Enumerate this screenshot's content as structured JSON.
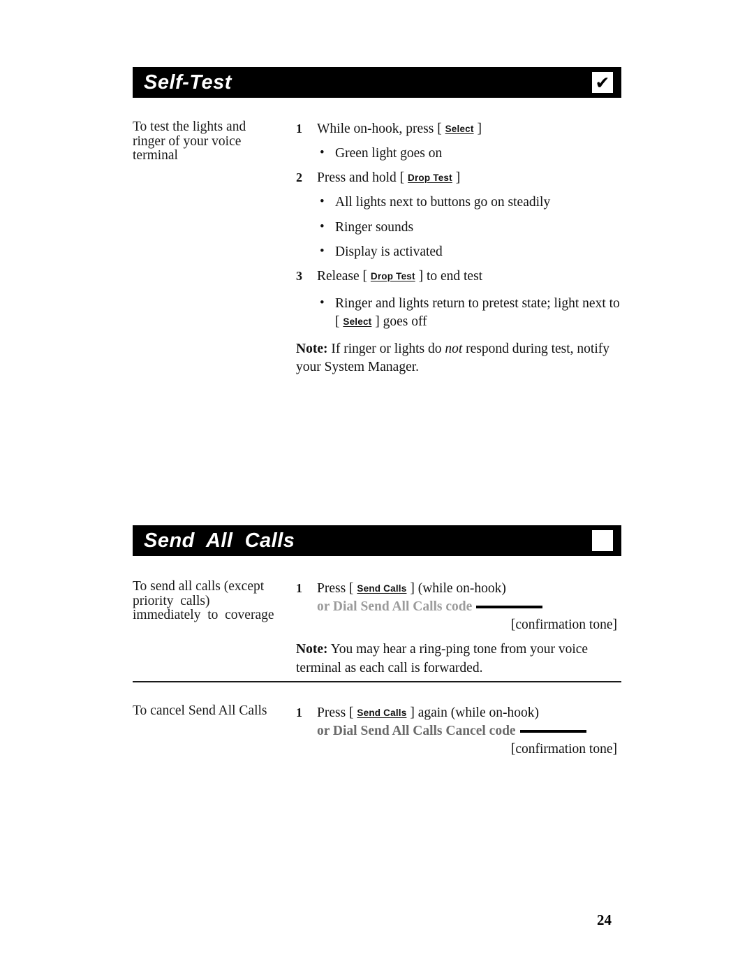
{
  "page": {
    "number": "24"
  },
  "sections": [
    {
      "id": "self-test",
      "title": "Self-Test",
      "marker_icon": "checkmark-icon",
      "marker_glyph": "✔",
      "left_note_lines": [
        "To test the lights and",
        "ringer of your voice",
        "terminal"
      ],
      "steps": [
        {
          "number": "1",
          "pre": "While on-hook, press [ ",
          "button": "Select",
          "post": " ]",
          "bullets": [
            "Green light goes on"
          ]
        },
        {
          "number": "2",
          "pre": "Press and hold [ ",
          "button": "Drop Test",
          "post": " ]",
          "bullets": [
            "All lights next to buttons go on steadily",
            "Ringer sounds",
            "Display is activated"
          ]
        },
        {
          "number": "3",
          "pre": "Release [ ",
          "button": "Drop Test",
          "post": " ] to end test",
          "bullets": []
        }
      ],
      "final_bullet": {
        "pre": "Ringer and lights return to pretest state; light next to [ ",
        "button": "Select",
        "post": " ] goes off"
      },
      "note": {
        "label": "Note:",
        "part1": " If ringer or lights do ",
        "emphasis": "not",
        "part2": " respond during test, notify your System Manager."
      }
    },
    {
      "id": "send-all-calls",
      "title": "Send  All  Calls",
      "marker_icon": "empty-square-icon",
      "marker_glyph": "",
      "left_note_lines": [
        "To send all calls (except",
        "priority  calls)",
        "immediately  to  coverage"
      ],
      "steps": [
        {
          "number": "1",
          "pre": "Press [ ",
          "button": "Send Calls",
          "post": " ] (while on-hook)",
          "dial_line": "or Dial Send All Calls code",
          "confirmation": "[confirmation tone]"
        }
      ],
      "note": {
        "label": "Note:",
        "text": " You may hear a ring-ping tone from your voice terminal as each call is forwarded."
      }
    },
    {
      "id": "cancel-send-all-calls",
      "left_note_lines": [
        "To cancel Send All Calls"
      ],
      "steps": [
        {
          "number": "1",
          "pre": "Press [ ",
          "button": "Send Calls",
          "post": " ] again (while on-hook)",
          "dial_line": "or Dial Send All Calls Cancel code",
          "confirmation": "[confirmation tone]"
        }
      ]
    }
  ]
}
